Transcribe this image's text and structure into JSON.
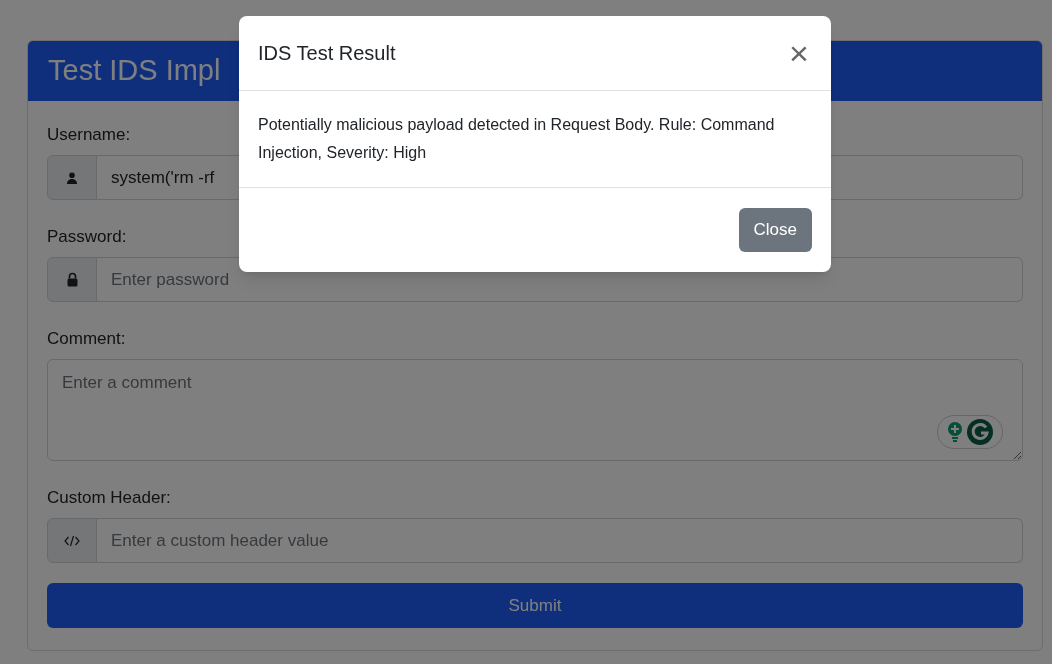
{
  "card": {
    "title": "Test IDS Impl"
  },
  "fields": [
    {
      "kind": "text",
      "label": "Username:",
      "value": "system('rm -rf"
    },
    {
      "kind": "password",
      "label": "Password:",
      "placeholder": "Enter password"
    },
    {
      "kind": "textarea",
      "label": "Comment:",
      "placeholder": "Enter a comment"
    },
    {
      "kind": "header",
      "label": "Custom Header:",
      "placeholder": "Enter a custom header value"
    }
  ],
  "submit": {
    "label": "Submit"
  },
  "modal": {
    "title": "IDS Test Result",
    "close_glyph": "×",
    "message": "Potentially malicious payload detected in Request Body. Rule: Command Injection, Severity: High",
    "button": "Close"
  }
}
